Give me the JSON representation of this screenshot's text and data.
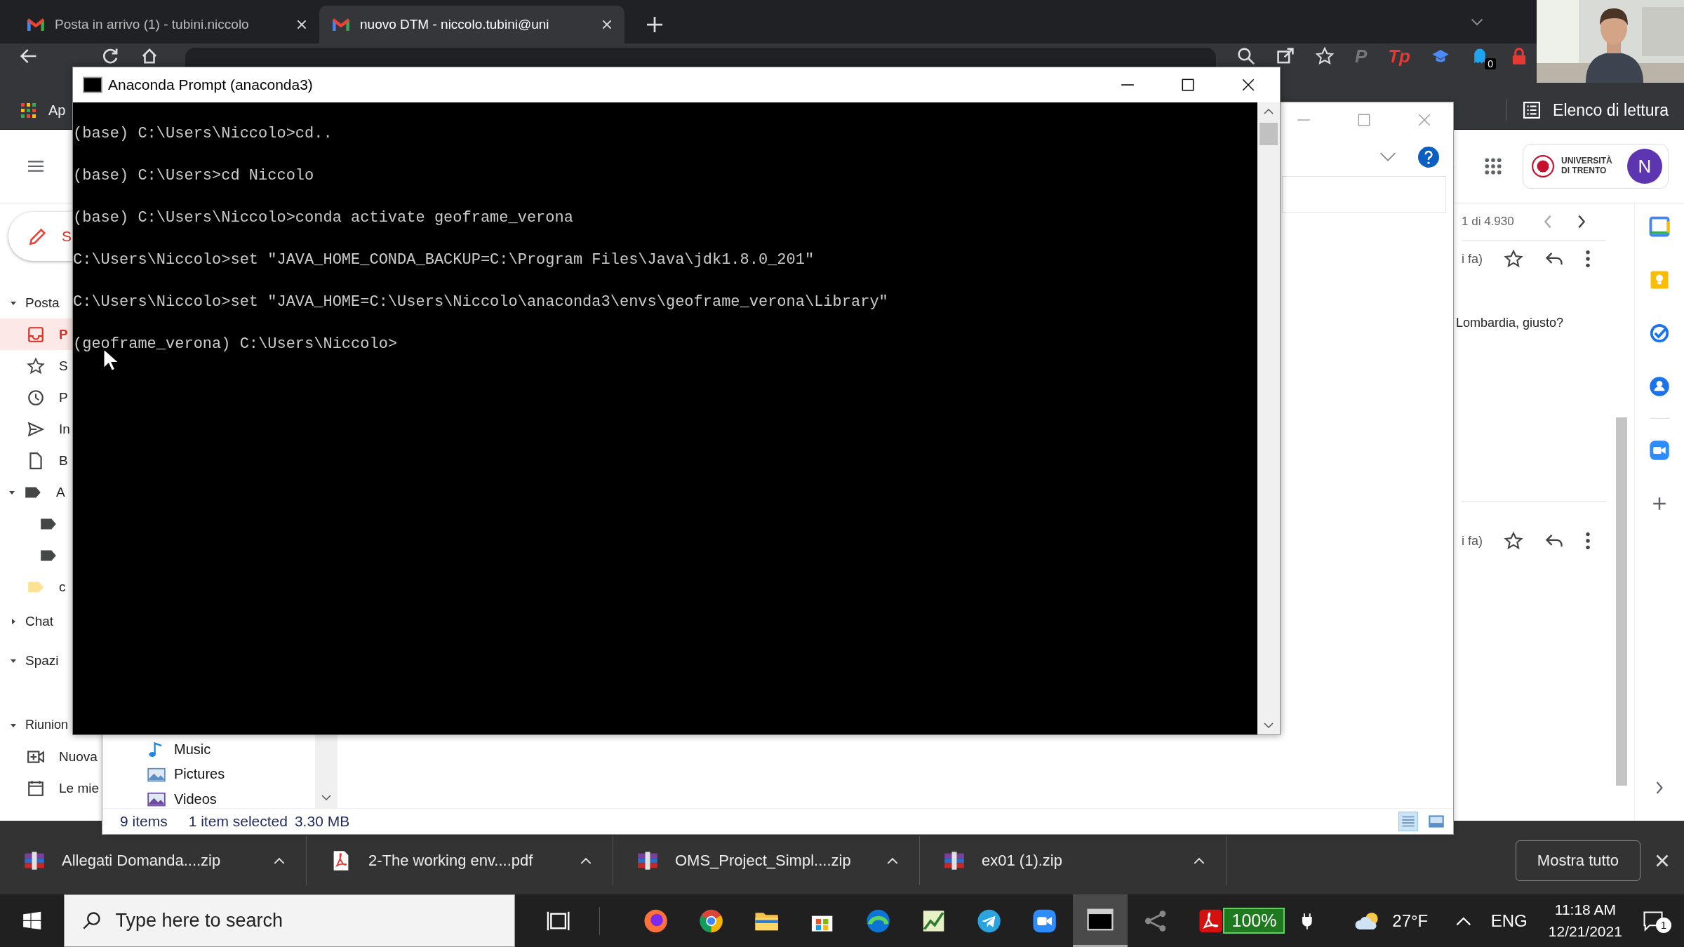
{
  "browser": {
    "tabs": [
      {
        "title": "Posta in arrivo (1) - tubini.niccolo",
        "selected": false
      },
      {
        "title": "nuovo DTM - niccolo.tubini@uni",
        "selected": true
      }
    ],
    "extensions": [
      "P",
      "Tp"
    ],
    "extension_badge": "0",
    "bookmarks": {
      "apps": "Ap",
      "reading_list": "Elenco di lettura"
    }
  },
  "gmail": {
    "sidebar": [
      {
        "kind": "compose",
        "label": "S"
      },
      {
        "kind": "section",
        "label": "Posta",
        "expanded": true
      },
      {
        "kind": "item",
        "label": "P",
        "selected": true
      },
      {
        "kind": "item",
        "label": "S",
        "selected": false
      },
      {
        "kind": "item",
        "label": "P",
        "selected": false
      },
      {
        "kind": "item",
        "label": "In",
        "selected": false
      },
      {
        "kind": "item",
        "label": "B",
        "selected": false
      },
      {
        "kind": "label",
        "label": "A",
        "color": "#444746",
        "expanded": true
      },
      {
        "kind": "sublabel",
        "color": "#444746"
      },
      {
        "kind": "sublabel",
        "color": "#444746"
      },
      {
        "kind": "label",
        "label": "c",
        "color": "#fde293"
      },
      {
        "kind": "section",
        "label": "Chat",
        "expanded": false
      },
      {
        "kind": "section",
        "label": "Spazi",
        "expanded": true
      },
      {
        "kind": "section",
        "label": "Riunion",
        "expanded": true
      },
      {
        "kind": "item",
        "label": "Nuova",
        "selected": false
      },
      {
        "kind": "item",
        "label": "Le mie",
        "selected": false
      }
    ],
    "account": {
      "org": "UNIVERSITÀ DI TRENTO",
      "avatar": "N"
    },
    "counter": "1 di 4.930",
    "messages": [
      {
        "time": "i fa)",
        "snippet": "Lombardia, giusto?"
      },
      {
        "time": "i fa)"
      }
    ]
  },
  "explorer": {
    "nav": [
      "Music",
      "Pictures",
      "Videos"
    ],
    "status": {
      "count": "9 items",
      "selection": "1 item selected",
      "size": "3.30 MB"
    }
  },
  "console": {
    "title": "Anaconda Prompt (anaconda3)",
    "lines": [
      "(base) C:\\Users\\Niccolo>cd..",
      "(base) C:\\Users>cd Niccolo",
      "(base) C:\\Users\\Niccolo>conda activate geoframe_verona",
      "C:\\Users\\Niccolo>set \"JAVA_HOME_CONDA_BACKUP=C:\\Program Files\\Java\\jdk1.8.0_201\"",
      "C:\\Users\\Niccolo>set \"JAVA_HOME=C:\\Users\\Niccolo\\anaconda3\\envs\\geoframe_verona\\Library\"",
      "(geoframe_verona) C:\\Users\\Niccolo>"
    ]
  },
  "downloads": {
    "items": [
      {
        "name": "Allegati Domanda....zip",
        "kind": "zip"
      },
      {
        "name": "2-The working env....pdf",
        "kind": "pdf"
      },
      {
        "name": "OMS_Project_Simpl....zip",
        "kind": "zip"
      },
      {
        "name": "ex01 (1).zip",
        "kind": "zip"
      }
    ],
    "show_all": "Mostra tutto"
  },
  "taskbar": {
    "search": {
      "placeholder": "Type here to search"
    },
    "battery": "100%",
    "temperature": "27°F",
    "language": "ENG",
    "time": "11:18 AM",
    "date": "12/21/2021",
    "notifications": "1"
  }
}
